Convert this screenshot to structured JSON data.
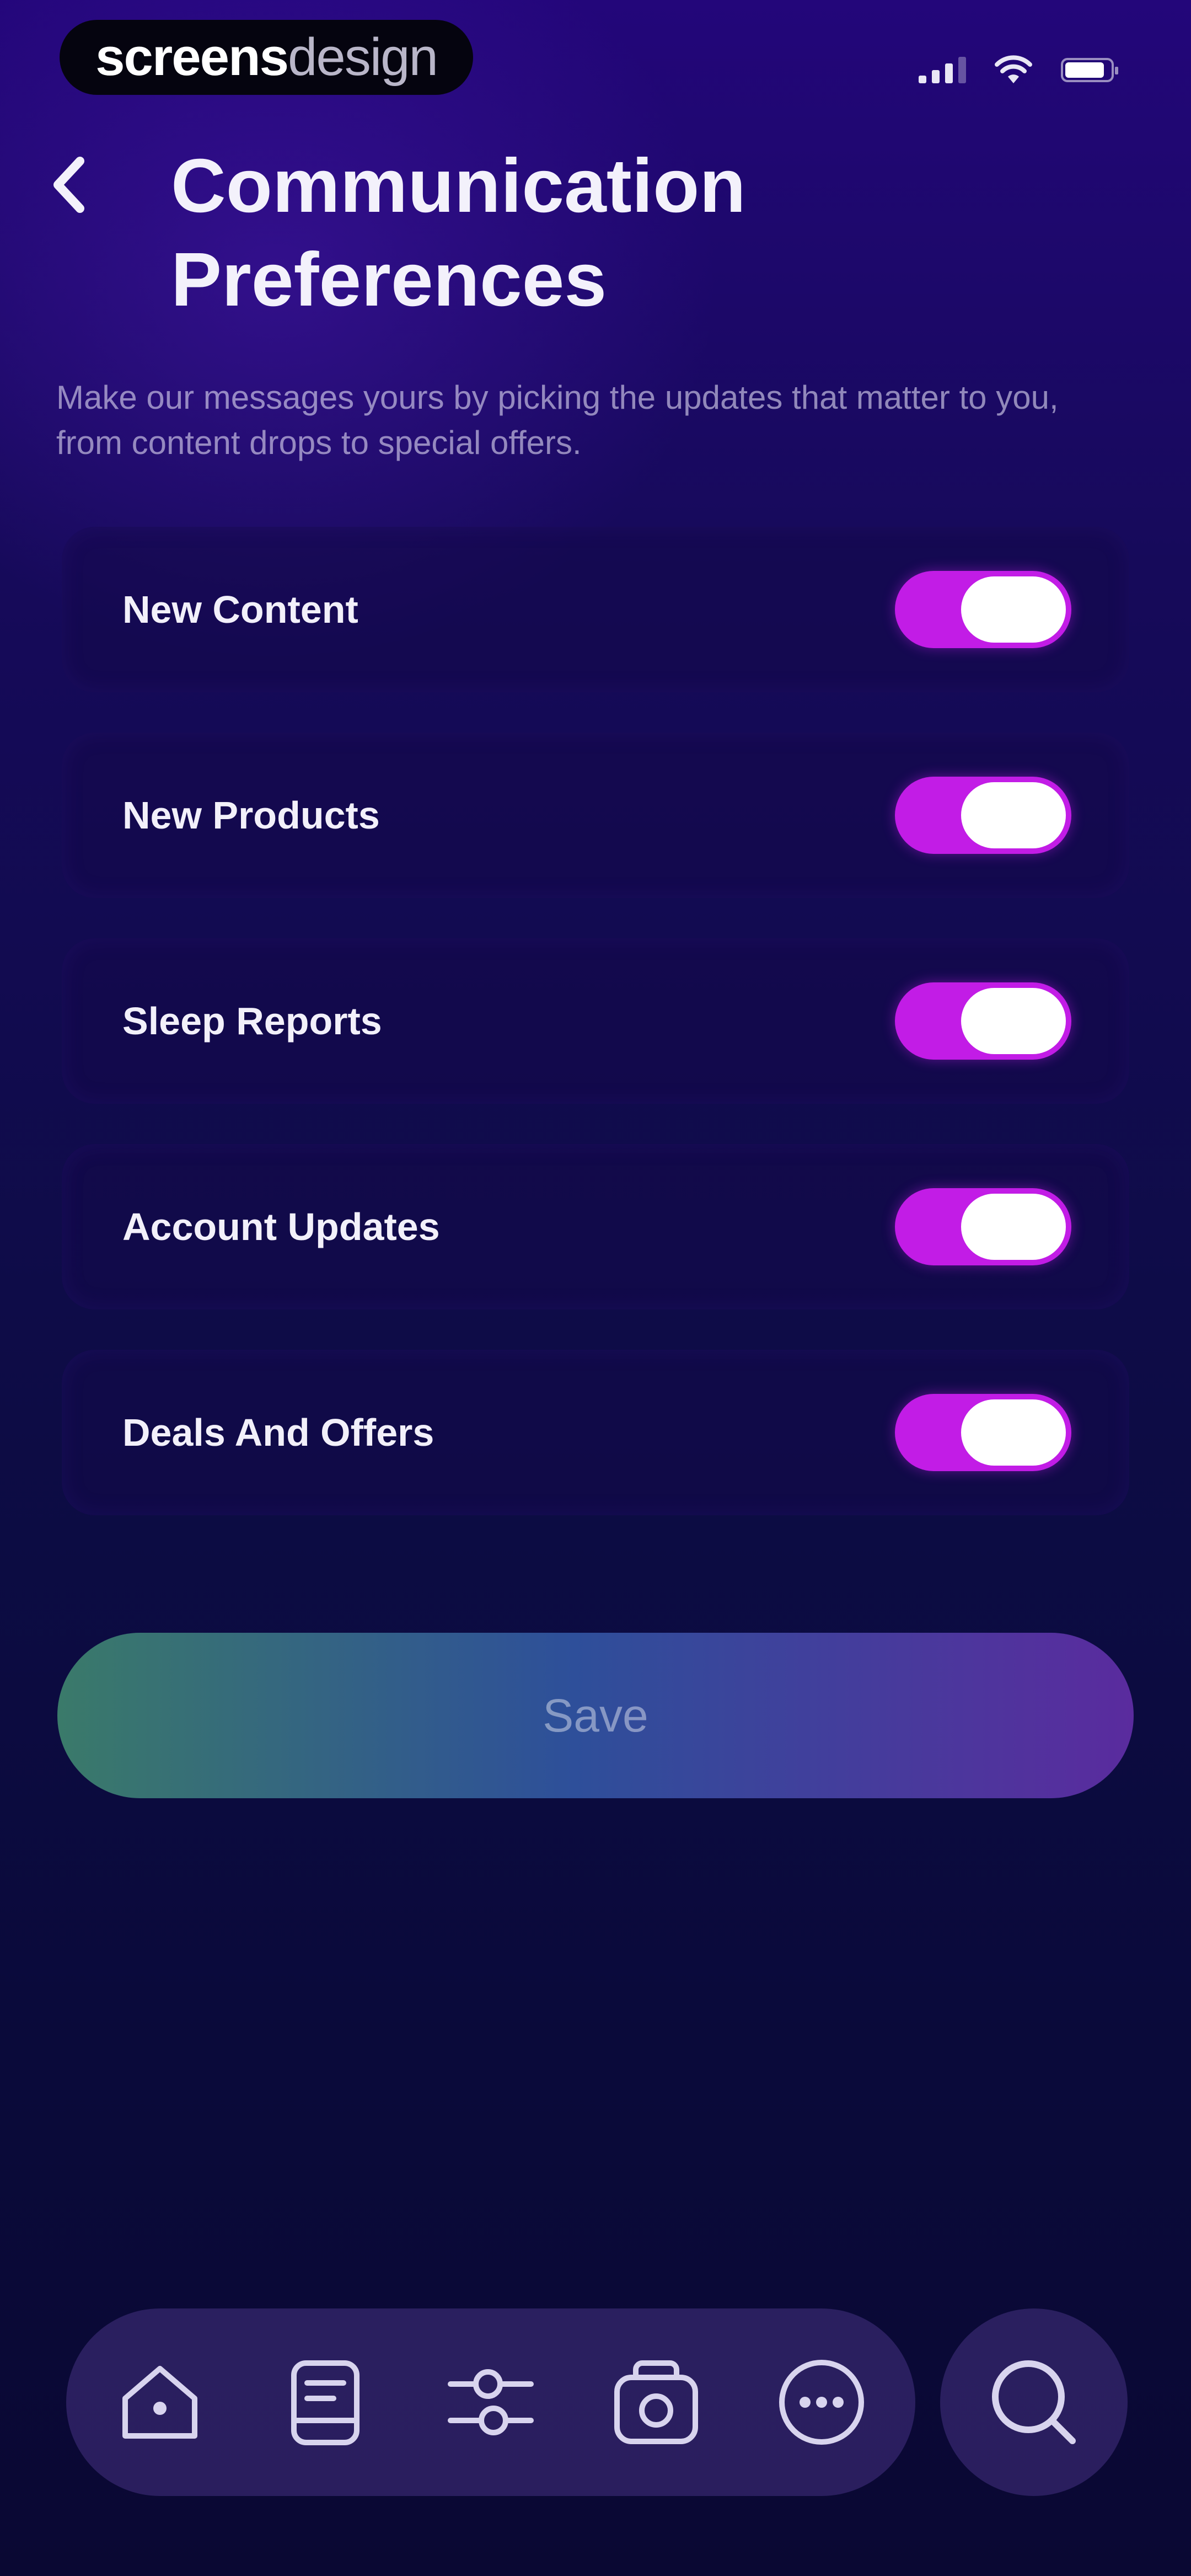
{
  "status_bar": {
    "brand_bold": "screens",
    "brand_light": "design"
  },
  "header": {
    "back_icon": "chevron-left-icon",
    "title": "Communication Preferences",
    "subtitle": "Make our messages yours by picking the updates that matter to you, from content drops to special offers."
  },
  "preferences": [
    {
      "label": "New Content",
      "enabled": true
    },
    {
      "label": "New Products",
      "enabled": true
    },
    {
      "label": "Sleep Reports",
      "enabled": true
    },
    {
      "label": "Account Updates",
      "enabled": true
    },
    {
      "label": "Deals And Offers",
      "enabled": true
    }
  ],
  "actions": {
    "save_label": "Save"
  },
  "nav": {
    "items": [
      "home-icon",
      "journal-icon",
      "sliders-icon",
      "radio-icon",
      "more-icon"
    ],
    "search_icon": "search-icon"
  },
  "colors": {
    "toggle_on": "#c21ce6",
    "save_gradient_start": "#3a7a6a",
    "save_gradient_end": "#5a2b9e",
    "background_top": "#23067a",
    "background_bottom": "#0a0833"
  }
}
